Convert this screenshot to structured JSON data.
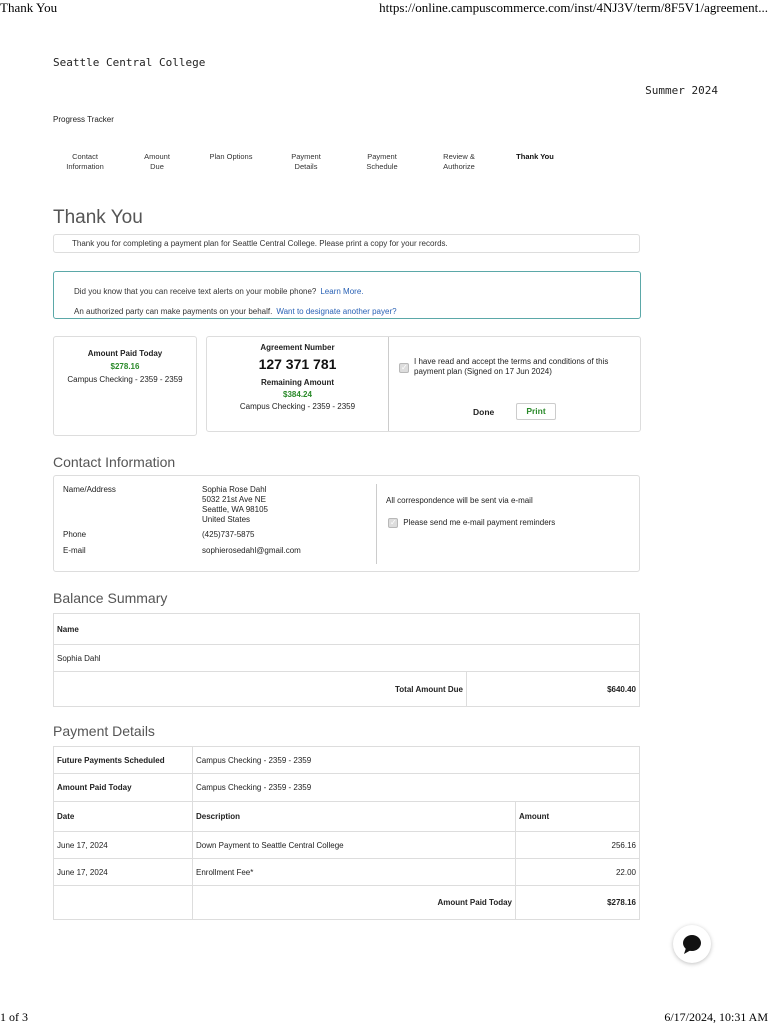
{
  "print_header": {
    "title": "Thank You",
    "url": "https://online.campuscommerce.com/inst/4NJ3V/term/8F5V1/agreement...",
    "page": "1 of 3",
    "datetime": "6/17/2024, 10:31 AM"
  },
  "college": "Seattle Central College",
  "term": "Summer 2024",
  "tracker": {
    "label": "Progress Tracker",
    "steps": [
      {
        "line1": "Contact",
        "line2": "Information"
      },
      {
        "line1": "Amount",
        "line2": "Due"
      },
      {
        "line1": "Plan Options",
        "line2": ""
      },
      {
        "line1": "Payment",
        "line2": "Details"
      },
      {
        "line1": "Payment",
        "line2": "Schedule"
      },
      {
        "line1": "Review &",
        "line2": "Authorize"
      },
      {
        "line1": "Thank You",
        "line2": ""
      }
    ]
  },
  "thank_you": {
    "heading": "Thank You",
    "message": "Thank you for completing a payment plan for Seattle Central College. Please print a copy for your records."
  },
  "alerts": {
    "text_alert": "Did you know that you can receive text alerts on your mobile phone?",
    "text_alert_link": "Learn More.",
    "payer": "An authorized party can make payments on your behalf.",
    "payer_link": "Want to designate another payer?"
  },
  "paid_today": {
    "label": "Amount Paid Today",
    "amount": "$278.16",
    "account": "Campus Checking - 2359 - 2359"
  },
  "agreement": {
    "number_label": "Agreement Number",
    "number": "127 371 781",
    "remaining_label": "Remaining Amount",
    "remaining": "$384.24",
    "account": "Campus Checking - 2359 - 2359",
    "terms": "I have read and accept the terms and conditions of this payment plan (Signed on 17 Jun 2024)",
    "done": "Done",
    "print": "Print"
  },
  "contact": {
    "heading": "Contact Information",
    "name_label": "Name/Address",
    "name": "Sophia Rose Dahl",
    "addr1": "5032 21st Ave NE",
    "addr2": "Seattle, WA 98105",
    "addr3": "United States",
    "phone_label": "Phone",
    "phone": "(425)737-5875",
    "email_label": "E-mail",
    "email": "sophierosedahl@gmail.com",
    "correspondence": "All correspondence will be sent via e-mail",
    "reminders": "Please send me e-mail payment reminders"
  },
  "balance": {
    "heading": "Balance Summary",
    "name_header": "Name",
    "name": "Sophia Dahl",
    "total_label": "Total Amount Due",
    "total": "$640.40"
  },
  "payment": {
    "heading": "Payment Details",
    "future_label": "Future Payments Scheduled",
    "future_value": "Campus Checking - 2359 - 2359",
    "paid_label": "Amount Paid Today",
    "paid_value": "Campus Checking - 2359 - 2359",
    "columns": [
      "Date",
      "Description",
      "Amount"
    ],
    "rows": [
      {
        "date": "June 17, 2024",
        "description": "Down Payment to Seattle Central College",
        "amount": "256.16"
      },
      {
        "date": "June 17, 2024",
        "description": "Enrollment Fee*",
        "amount": "22.00"
      }
    ],
    "total_label": "Amount Paid Today",
    "total": "$278.16"
  }
}
